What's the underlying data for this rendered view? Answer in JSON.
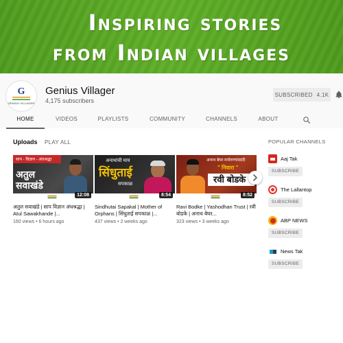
{
  "banner": {
    "line1": "Inspiring stories",
    "line2": "from Indian villages"
  },
  "channel": {
    "name": "Genius Villager",
    "subscribers": "4,175 subscribers",
    "avatar_mark": "G",
    "avatar_brand": "GENIUS VILLAGER",
    "subscribe_label": "SUBSCRIBED",
    "subscribe_count": "4.1K",
    "bell_icon": "bell-icon"
  },
  "tabs": [
    {
      "label": "HOME",
      "active": true
    },
    {
      "label": "VIDEOS",
      "active": false
    },
    {
      "label": "PLAYLISTS",
      "active": false
    },
    {
      "label": "COMMUNITY",
      "active": false
    },
    {
      "label": "CHANNELS",
      "active": false
    },
    {
      "label": "ABOUT",
      "active": false
    }
  ],
  "search_icon": "search-icon",
  "uploads": {
    "title": "Uploads",
    "play_all": "PLAY ALL",
    "videos": [
      {
        "title": "अतुल सवाखंडे | साप विज्ञान अंधश्रद्धा | Atul Sawakhande |...",
        "meta": "160 views • 6 hours ago",
        "duration": "12:08",
        "thumb_top": "साप - विज्ञान - अंधश्रद्धा",
        "thumb_main": "अतुल सवाखंडे"
      },
      {
        "title": "Sindhutai Sapakal | Mother of Orphans | सिंधुताई सपकाळ |...",
        "meta": "437 views • 2 weeks ago",
        "duration": "8:54",
        "thumb_top": "अनाथांची माय",
        "thumb_main": "सिंधुताई",
        "thumb_sub": "सपकाळ"
      },
      {
        "title": "Ravi Bodke | Yashodhan Trust | रवी बोडके | अनाथ बेघर...",
        "meta": "323 views • 3 weeks ago",
        "duration": "8:52",
        "thumb_top": "अनाथ बेघर मनोरुग्णांसाठी",
        "thumb_mid": "\" निवारा \"",
        "thumb_main": "रवी बोडके"
      }
    ]
  },
  "popular": {
    "title": "POPULAR CHANNELS",
    "subscribe_label": "SUBSCRIBE",
    "channels": [
      {
        "name": "Aaj Tak",
        "icon": "aaj-tak-logo-icon",
        "color": "#d7261e"
      },
      {
        "name": "The Lallantop",
        "icon": "lallantop-logo-icon",
        "color": "#e5322d"
      },
      {
        "name": "ABP NEWS",
        "icon": "abp-news-logo-icon",
        "color": "#d62b1f"
      },
      {
        "name": "News Tak",
        "icon": "news-tak-logo-icon",
        "color": "#1a9ad6"
      }
    ]
  },
  "colors": {
    "banner_green": "#5fae27",
    "text_primary": "#0f0f0f",
    "text_secondary": "#606060",
    "button_grey": "#ececec"
  }
}
